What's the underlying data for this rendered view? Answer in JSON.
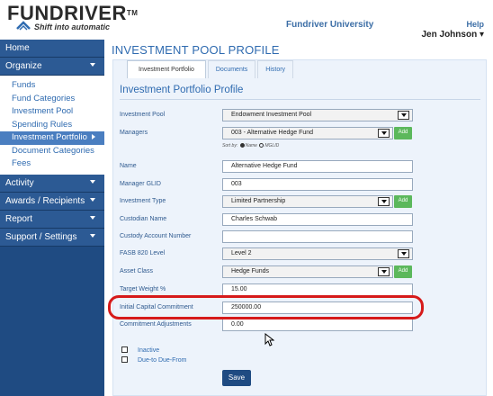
{
  "header": {
    "logo_text": "FUNDRIVER",
    "logo_tagline": "Shift into automatic",
    "university_link": "Fundriver University",
    "help_link": "Help",
    "user_name": "Jen Johnson"
  },
  "sidebar": {
    "home": "Home",
    "organize": "Organize",
    "organize_items": [
      "Funds",
      "Fund Categories",
      "Investment Pool",
      "Spending Rules",
      "Investment Portfolio",
      "Document Categories",
      "Fees"
    ],
    "sections": [
      "Activity",
      "Awards / Recipients",
      "Report",
      "Support / Settings"
    ]
  },
  "main": {
    "page_title": "INVESTMENT POOL PROFILE",
    "tabs": [
      "Investment Portfolio",
      "Documents",
      "History"
    ],
    "section_title": "Investment Portfolio Profile",
    "fields": {
      "investment_pool": {
        "label": "Investment Pool",
        "value": "Endowment Investment Pool"
      },
      "managers": {
        "label": "Managers",
        "value": "003 - Alternative Hedge Fund"
      },
      "sort_by": {
        "label": "Sort by:",
        "option1": "Name",
        "option2": "MGLID"
      },
      "name": {
        "label": "Name",
        "value": "Alternative Hedge Fund"
      },
      "manager_glid": {
        "label": "Manager GLID",
        "value": "003"
      },
      "investment_type": {
        "label": "Investment Type",
        "value": "Limited Partnership"
      },
      "custodian_name": {
        "label": "Custodian Name",
        "value": "Charles Schwab"
      },
      "custody_account": {
        "label": "Custody Account Number",
        "value": ""
      },
      "fasb_level": {
        "label": "FASB 820 Level",
        "value": "Level 2"
      },
      "asset_class": {
        "label": "Asset Class",
        "value": "Hedge Funds"
      },
      "target_weight": {
        "label": "Target Weight %",
        "value": "15.00"
      },
      "initial_capital": {
        "label": "Initial Capital Commitment",
        "value": "250000.00"
      },
      "commitment_adj": {
        "label": "Commitment Adjustments",
        "value": "0.00"
      }
    },
    "add_label": "Add",
    "checkbox_inactive": "Inactive",
    "checkbox_due": "Due-to Due-From",
    "save_label": "Save"
  },
  "colors": {
    "sidebar_bg": "#1f4b82",
    "accent": "#2f6bb0",
    "add_button": "#5cb85c",
    "highlight": "#d61a1a"
  }
}
